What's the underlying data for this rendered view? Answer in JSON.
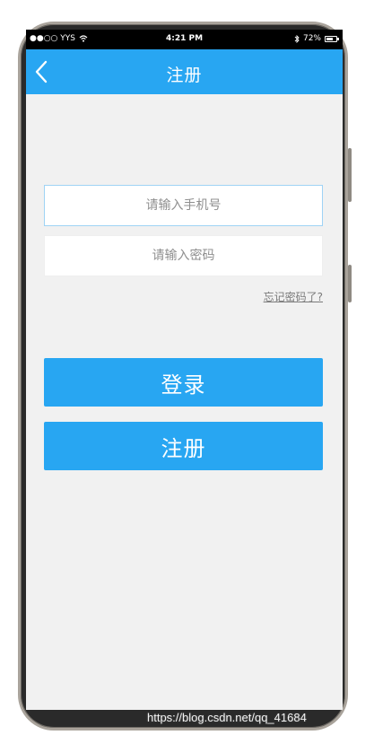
{
  "status_bar": {
    "carrier": "●●○○ YYS",
    "time": "4:21 PM",
    "battery_text": "72%",
    "battery_level": 0.72
  },
  "nav": {
    "title": "注册"
  },
  "form": {
    "phone_placeholder": "请输入手机号",
    "password_placeholder": "请输入密码",
    "forgot_label": "忘记密码了?"
  },
  "buttons": {
    "login_label": "登录",
    "register_label": "注册"
  },
  "colors": {
    "accent": "#28a6f2",
    "background": "#f1f1f1"
  },
  "icons": {
    "back": "back-icon",
    "wifi": "wifi-icon",
    "bluetooth": "bluetooth-icon",
    "battery": "battery-icon"
  },
  "watermark": "https://blog.csdn.net/qq_41684"
}
